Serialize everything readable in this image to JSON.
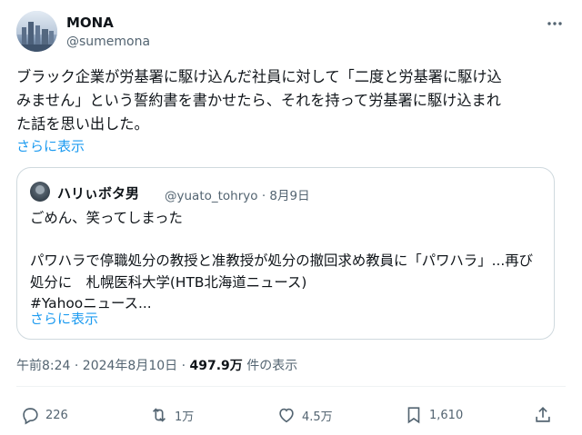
{
  "author": {
    "display_name": "MONA",
    "handle": "@sumemona"
  },
  "tweet": {
    "lines": [
      "ブラック企業が労基署に駆け込んだ社員に対して「二度と労基署に駆け込",
      "みません」という誓約書を書かせたら、それを持って労基署に駆け込まれ",
      "た話を思い出した。"
    ],
    "show_more": "さらに表示"
  },
  "quote": {
    "display_name": "ハリぃボタ男",
    "handle_and_date": "@yuato_tohryo · 8月9日",
    "lines": [
      "ごめん、笑ってしまった",
      "",
      "パワハラで停職処分の教授と准教授が処分の撤回求め教員に「パワハラ」...再び",
      "処分に　札幌医科大学(HTB北海道ニュース)",
      "#Yahooニュース..."
    ],
    "show_more": "さらに表示"
  },
  "meta": {
    "timestamp": "午前8:24 · 2024年8月10日 · ",
    "views_count": "497.9万",
    "views_label": " 件の表示"
  },
  "actions": {
    "reply_count": "226",
    "retweet_count": "1万",
    "like_count": "4.5万",
    "bookmark_count": "1,610"
  },
  "icons": {
    "more": "more-icon",
    "reply": "reply-icon",
    "retweet": "retweet-icon",
    "like": "heart-icon",
    "bookmark": "bookmark-icon",
    "share": "share-icon"
  },
  "colors": {
    "link": "#1d9bf0",
    "secondary_text": "#536471",
    "primary_text": "#0f1419",
    "border": "#cfd9de"
  }
}
